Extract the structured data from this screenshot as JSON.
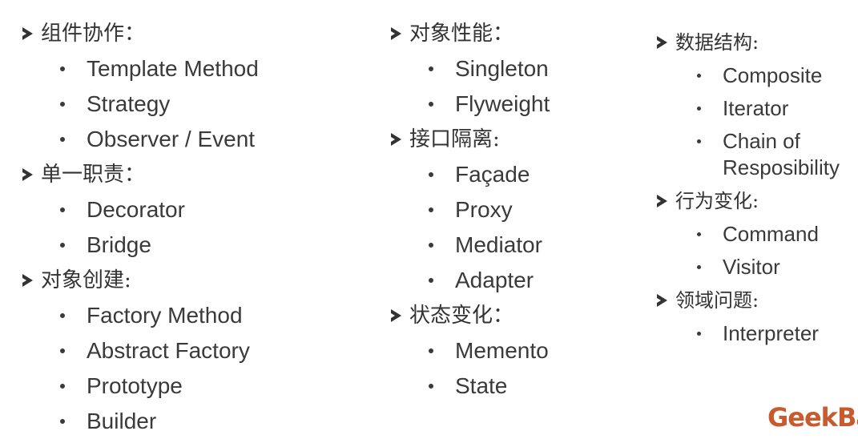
{
  "columns": [
    {
      "groups": [
        {
          "heading": "组件协作：",
          "items": [
            "Template Method",
            "Strategy",
            "Observer / Event"
          ]
        },
        {
          "heading": "单一职责：",
          "items": [
            "Decorator",
            "Bridge"
          ]
        },
        {
          "heading": "对象创建:",
          "items": [
            "Factory Method",
            "Abstract Factory",
            "Prototype",
            "Builder"
          ]
        }
      ]
    },
    {
      "groups": [
        {
          "heading": "对象性能：",
          "items": [
            "Singleton",
            "Flyweight"
          ]
        },
        {
          "heading": "接口隔离:",
          "items": [
            "Façade",
            "Proxy",
            "Mediator",
            "Adapter"
          ]
        },
        {
          "heading": "状态变化：",
          "items": [
            "Memento",
            "State"
          ]
        }
      ]
    },
    {
      "groups": [
        {
          "heading": "数据结构:",
          "items": [
            "Composite",
            "Iterator",
            "Chain of Resposibility"
          ]
        },
        {
          "heading": "行为变化:",
          "items": [
            "Command",
            "Visitor"
          ]
        },
        {
          "heading": "领域问题:",
          "items": [
            "Interpreter"
          ]
        }
      ]
    }
  ],
  "logo": {
    "text": "GeekBa"
  },
  "colors": {
    "text": "#3a3a3a",
    "logo": "#c85a2e",
    "background": "#ffffff"
  }
}
